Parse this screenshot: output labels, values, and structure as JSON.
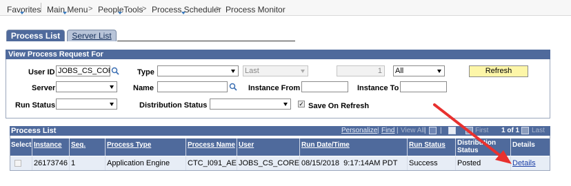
{
  "breadcrumb": {
    "favorites": "Favorites",
    "main_menu": "Main Menu",
    "sep1": ">",
    "peopletools": "PeopleTools",
    "sep2": ">",
    "process_scheduler": "Process Scheduler",
    "sep3": ">",
    "process_monitor": "Process Monitor"
  },
  "tabs": [
    {
      "label": "Process List",
      "active": true
    },
    {
      "label": "Server List",
      "active": false
    }
  ],
  "criteria": {
    "title": "View Process Request For",
    "user_id_label": "User ID",
    "user_id_value": "JOBS_CS_COR",
    "type_label": "Type",
    "type_value": "",
    "last_value": "Last",
    "last_count": "1",
    "range_value": "All",
    "refresh_label": "Refresh",
    "server_label": "Server",
    "server_value": "",
    "name_label": "Name",
    "name_value": "",
    "instance_from_label": "Instance From",
    "instance_from_value": "",
    "instance_to_label": "Instance To",
    "instance_to_value": "",
    "run_status_label": "Run Status",
    "run_status_value": "",
    "distribution_status_label": "Distribution Status",
    "distribution_status_value": "",
    "save_on_refresh_label": "Save On Refresh",
    "save_on_refresh_checked": true
  },
  "process_list": {
    "title": "Process List",
    "personalize": "Personalize",
    "find": "Find",
    "view_all": "View All",
    "first": "First",
    "page_indicator": "1 of 1",
    "last": "Last",
    "sep": "|",
    "columns": [
      "Select",
      "Instance",
      "Seq.",
      "Process Type",
      "Process Name",
      "User",
      "Run Date/Time",
      "Run Status",
      "Distribution Status",
      "Details"
    ],
    "rows": [
      {
        "instance": "26173746",
        "seq": "1",
        "process_type": "Application Engine",
        "process_name": "CTC_I091_AE",
        "user": "JOBS_CS_CORE",
        "run_date_time": "08/15/2018  9:17:14AM PDT",
        "run_status": "Success",
        "distribution_status": "Posted",
        "details": "Details"
      }
    ]
  },
  "colors": {
    "header_blue": "#4f6a9c",
    "row_bg": "#e7edf6",
    "refresh_bg": "#fdf6a8",
    "annotation_arrow": "#e8312f",
    "link": "#1a3ea6"
  }
}
